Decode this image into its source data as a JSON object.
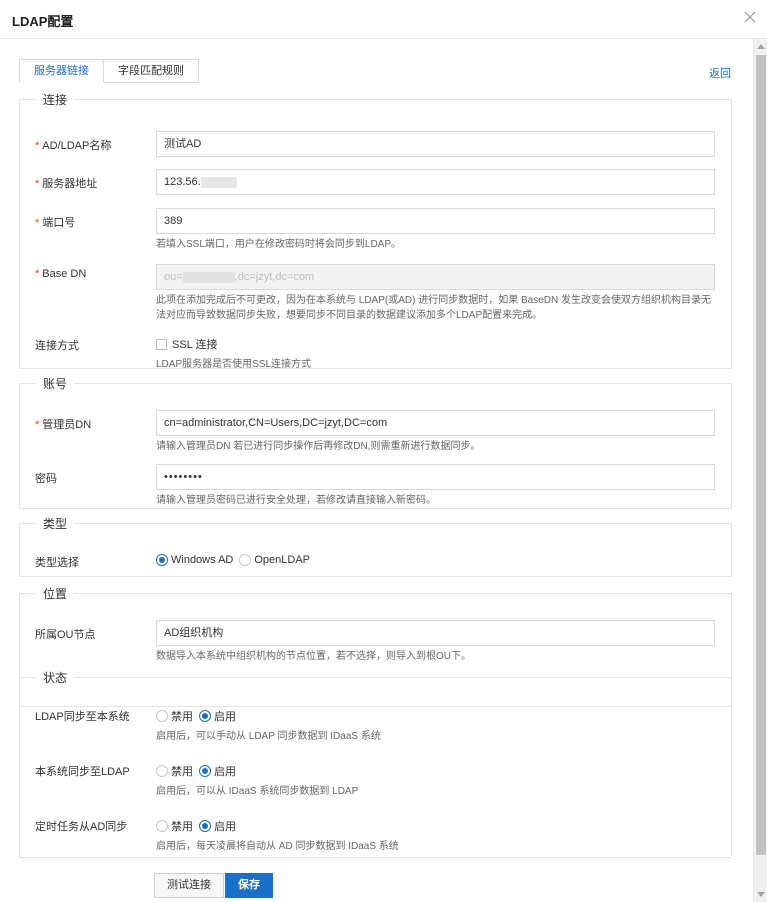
{
  "dialog": {
    "title": "LDAP配置"
  },
  "tabs": [
    {
      "label": "服务器链接",
      "active": true
    },
    {
      "label": "字段匹配规则",
      "active": false
    }
  ],
  "back_link": "返回",
  "sections": {
    "connection": {
      "legend": "连接",
      "name": {
        "label": "AD/LDAP名称",
        "value": "测试AD"
      },
      "server": {
        "label": "服务器地址",
        "value": "123.56."
      },
      "port": {
        "label": "端口号",
        "value": "389",
        "hint": "若填入SSL端口，用户在修改密码时将会同步到LDAP。"
      },
      "base_dn": {
        "label": "Base DN",
        "value_prefix": "ou=",
        "value_suffix": ",dc=jzyt,dc=com",
        "hint": "此项在添加完成后不可更改，因为在本系统与 LDAP(或AD) 进行同步数据时，如果 BaseDN 发生改变会使双方组织机构目录无法对应而导致数据同步失败，想要同步不同目录的数据建议添加多个LDAP配置来完成。"
      },
      "method": {
        "label": "连接方式",
        "checkbox_label": "SSL 连接",
        "checked": false,
        "hint": "LDAP服务器是否使用SSL连接方式"
      }
    },
    "account": {
      "legend": "账号",
      "admin_dn": {
        "label": "管理员DN",
        "value": "cn=administrator,CN=Users,DC=jzyt,DC=com",
        "hint": "请输入管理员DN 若已进行同步操作后再修改DN,则需重新进行数据同步。"
      },
      "password": {
        "label": "密码",
        "value": "••••••••",
        "hint": "请输入管理员密码已进行安全处理，若修改请直接输入新密码。"
      }
    },
    "type": {
      "legend": "类型",
      "label": "类型选择",
      "options": [
        "Windows AD",
        "OpenLDAP"
      ],
      "selected": "Windows AD"
    },
    "location": {
      "legend": "位置",
      "label": "所属OU节点",
      "value": "AD组织机构",
      "hint": "数据导入本系统中组织机构的节点位置，若不选择，则导入到根OU下。"
    },
    "status": {
      "legend": "状态",
      "off_label": "禁用",
      "on_label": "启用",
      "rows": [
        {
          "label": "LDAP同步至本系统",
          "selected": "启用",
          "hint": "启用后，可以手动从 LDAP 同步数据到 IDaaS 系统"
        },
        {
          "label": "本系统同步至LDAP",
          "selected": "启用",
          "hint": "启用后，可以从 IDaaS 系统同步数据到 LDAP"
        },
        {
          "label": "定时任务从AD同步",
          "selected": "启用",
          "hint": "启用后，每天凌晨将自动从 AD 同步数据到 IDaaS 系统"
        }
      ]
    }
  },
  "buttons": {
    "test": "测试连接",
    "save": "保存"
  }
}
